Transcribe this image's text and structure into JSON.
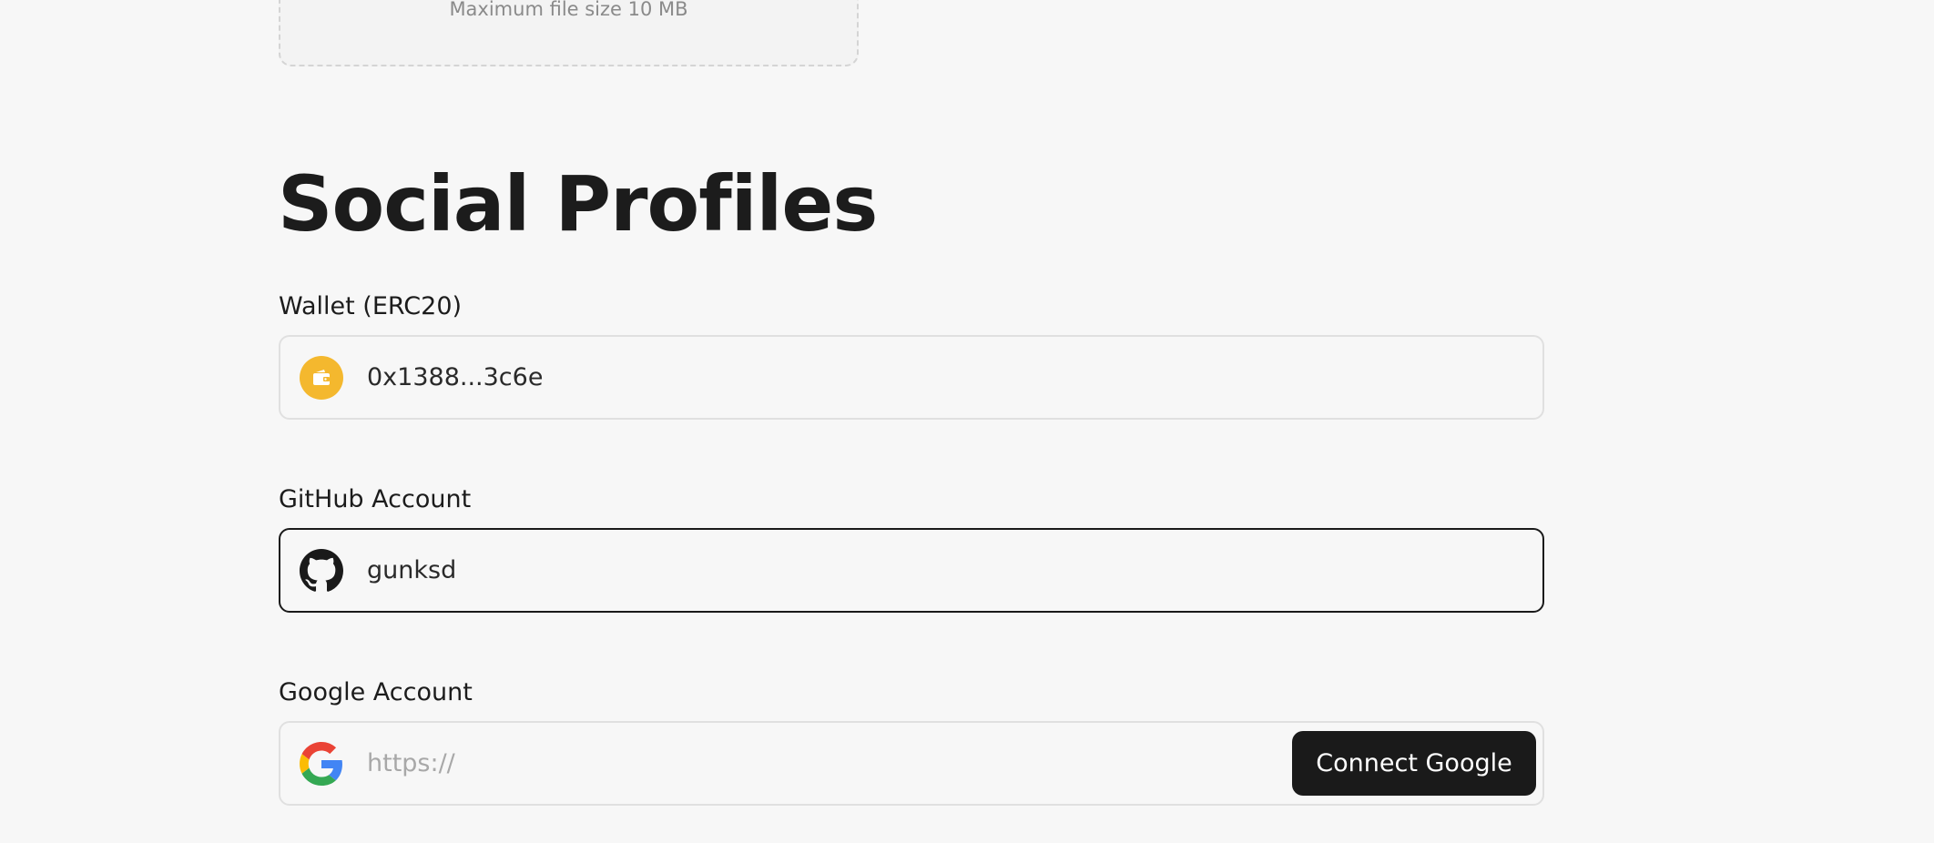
{
  "upload": {
    "hint": "Maximum file size 10 MB"
  },
  "social_profiles": {
    "title": "Social Profiles",
    "wallet": {
      "label": "Wallet (ERC20)",
      "value": "0x1388...3c6e",
      "icon": "wallet-icon",
      "icon_color": "#f4b82e"
    },
    "github": {
      "label": "GitHub Account",
      "value": "gunksd",
      "icon": "github-icon"
    },
    "google": {
      "label": "Google Account",
      "value": "",
      "placeholder": "https://",
      "icon": "google-icon",
      "connect_label": "Connect Google"
    }
  },
  "colors": {
    "background": "#f7f7f7",
    "button_bg": "#1a1a1a",
    "focus_border": "#1a1a1a"
  }
}
